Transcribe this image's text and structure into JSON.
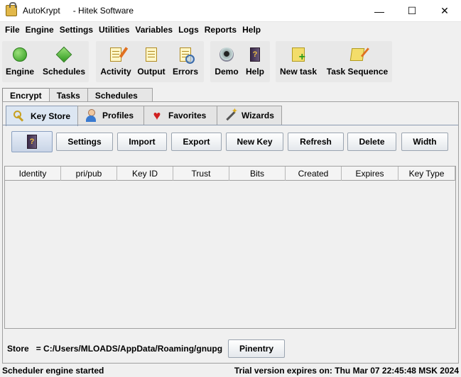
{
  "window": {
    "app_name": "AutoKrypt",
    "title": "- Hitek Software",
    "minimize": "—",
    "maximize": "☐",
    "close": "✕"
  },
  "menu": [
    "File",
    "Engine",
    "Settings",
    "Utilities",
    "Variables",
    "Logs",
    "Reports",
    "Help"
  ],
  "toolbar": {
    "engine": "Engine",
    "schedules": "Schedules",
    "activity": "Activity",
    "output": "Output",
    "errors": "Errors",
    "demo": "Demo",
    "help": "Help",
    "new_task": "New task",
    "task_sequence": "Task Sequence"
  },
  "outer_tabs": [
    "Encrypt",
    "Tasks",
    "Schedules"
  ],
  "inner_tabs": [
    "Key Store",
    "Profiles",
    "Favorites",
    "Wizards"
  ],
  "buttons": {
    "help_glyph": "?",
    "settings": "Settings",
    "import": "Import",
    "export": "Export",
    "new_key": "New Key",
    "refresh": "Refresh",
    "delete": "Delete",
    "width": "Width"
  },
  "table": {
    "columns": [
      "Identity",
      "pri/pub",
      "Key ID",
      "Trust",
      "Bits",
      "Created",
      "Expires",
      "Key Type"
    ],
    "rows": []
  },
  "store": {
    "label": "Store",
    "path": "= C:/Users/MLOADS/AppData/Roaming/gnupg",
    "pinentry": "Pinentry"
  },
  "status": {
    "left": "Scheduler engine started",
    "right": "Trial version expires on: Thu Mar 07 22:45:48 MSK 2024"
  }
}
